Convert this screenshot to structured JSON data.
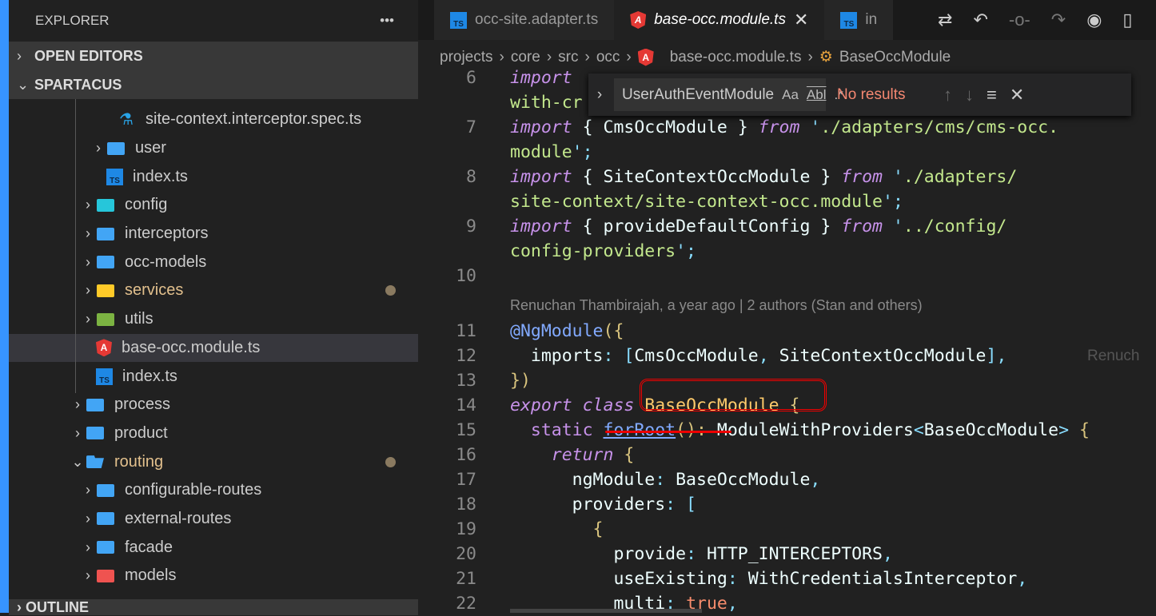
{
  "sidebar": {
    "title": "EXPLORER",
    "more_icon": "ellipsis-icon",
    "sections": {
      "open_editors": "OPEN EDITORS",
      "workspace": "SPARTACUS",
      "outline": "OUTLINE"
    },
    "tree": [
      {
        "label": "site-context.interceptor.spec.ts",
        "icon": "test-flask-icon",
        "depth": 3,
        "chevron": "none"
      },
      {
        "label": "user",
        "icon": "folder-icon",
        "depth": 2,
        "chevron": "right"
      },
      {
        "label": "index.ts",
        "icon": "typescript-icon",
        "depth": 2,
        "chevron": "none"
      },
      {
        "label": "config",
        "icon": "folder-config-icon",
        "depth": 1,
        "chevron": "right"
      },
      {
        "label": "interceptors",
        "icon": "folder-icon",
        "depth": 1,
        "chevron": "right"
      },
      {
        "label": "occ-models",
        "icon": "folder-icon",
        "depth": 1,
        "chevron": "right"
      },
      {
        "label": "services",
        "icon": "folder-services-icon",
        "depth": 1,
        "chevron": "right",
        "modified": true
      },
      {
        "label": "utils",
        "icon": "folder-utils-icon",
        "depth": 1,
        "chevron": "right"
      },
      {
        "label": "base-occ.module.ts",
        "icon": "angular-icon",
        "depth": 1,
        "chevron": "none",
        "selected": true
      },
      {
        "label": "index.ts",
        "icon": "typescript-icon",
        "depth": 1,
        "chevron": "none"
      },
      {
        "label": "process",
        "icon": "folder-icon",
        "depth": 0,
        "chevron": "right"
      },
      {
        "label": "product",
        "icon": "folder-icon",
        "depth": 0,
        "chevron": "right"
      },
      {
        "label": "routing",
        "icon": "folder-open-icon",
        "depth": 0,
        "chevron": "down",
        "modified": true
      },
      {
        "label": "configurable-routes",
        "icon": "folder-icon",
        "depth": 1,
        "chevron": "right"
      },
      {
        "label": "external-routes",
        "icon": "folder-icon",
        "depth": 1,
        "chevron": "right"
      },
      {
        "label": "facade",
        "icon": "folder-icon",
        "depth": 1,
        "chevron": "right"
      },
      {
        "label": "models",
        "icon": "folder-models-icon",
        "depth": 1,
        "chevron": "right"
      }
    ]
  },
  "tabs": [
    {
      "label": "occ-site.adapter.ts",
      "icon": "typescript-icon"
    },
    {
      "label": "base-occ.module.ts",
      "icon": "angular-icon",
      "active": true
    },
    {
      "label": "in",
      "icon": "typescript-icon"
    }
  ],
  "toolbar_icons": [
    "source-control-compare-icon",
    "go-back-icon",
    "git-commit-icon",
    "go-forward-icon",
    "git-graph-icon",
    "split-editor-icon"
  ],
  "breadcrumb": [
    "projects",
    "core",
    "src",
    "occ",
    "base-occ.module.ts",
    "BaseOccModule"
  ],
  "find": {
    "value": "UserAuthEventModule",
    "match_case": "Aa",
    "whole_word": "Abl",
    "regex": ".*",
    "status": "No results"
  },
  "code": [
    {
      "n": "6",
      "t": [
        [
          "import",
          "kw"
        ]
      ]
    },
    {
      "n": "",
      "t": [
        [
          "with-cr",
          "st"
        ]
      ]
    },
    {
      "n": "7",
      "t": [
        [
          "import",
          "kw"
        ],
        [
          " { CmsOccModule } ",
          ""
        ],
        [
          "from",
          "kw"
        ],
        [
          " '",
          "pu"
        ],
        [
          "./adapters/cms/cms-occ.",
          "st"
        ]
      ]
    },
    {
      "n": "",
      "t": [
        [
          "module",
          "st"
        ],
        [
          "';",
          "pu"
        ]
      ]
    },
    {
      "n": "8",
      "t": [
        [
          "import",
          "kw"
        ],
        [
          " { SiteContextOccModule } ",
          ""
        ],
        [
          "from",
          "kw"
        ],
        [
          " '",
          "pu"
        ],
        [
          "./adapters/",
          "st"
        ]
      ]
    },
    {
      "n": "",
      "t": [
        [
          "site-context/site-context-occ.module",
          "st"
        ],
        [
          "';",
          "pu"
        ]
      ]
    },
    {
      "n": "9",
      "t": [
        [
          "import",
          "kw"
        ],
        [
          " { provideDefaultConfig } ",
          ""
        ],
        [
          "from",
          "kw"
        ],
        [
          " '",
          "pu"
        ],
        [
          "../config/",
          "st"
        ]
      ]
    },
    {
      "n": "",
      "t": [
        [
          "config-providers",
          "st"
        ],
        [
          "';",
          "pu"
        ]
      ]
    },
    {
      "n": "10",
      "t": []
    },
    {
      "n": "",
      "blame": "Renuchan Thambirajah, a year ago | 2 authors (Stan and others)"
    },
    {
      "n": "11",
      "t": [
        [
          "@NgModule",
          "fn"
        ],
        [
          "({",
          "br"
        ]
      ]
    },
    {
      "n": "12",
      "t": [
        [
          "  imports",
          ""
        ],
        [
          ": [",
          "pu"
        ],
        [
          "CmsOccModule",
          ""
        ],
        [
          ", ",
          "pu"
        ],
        [
          "SiteContextOccModule",
          ""
        ],
        [
          "],",
          "pu"
        ]
      ],
      "ghost": "Renuch"
    },
    {
      "n": "13",
      "t": [
        [
          "})",
          "br"
        ]
      ]
    },
    {
      "n": "14",
      "t": [
        [
          "export class",
          "kw"
        ],
        [
          " ",
          ""
        ],
        [
          "BaseOccModule",
          "cn"
        ],
        [
          " {",
          "br"
        ]
      ]
    },
    {
      "n": "15",
      "t": [
        [
          "  static ",
          "st2"
        ],
        [
          "forRoot",
          "fn"
        ],
        [
          "(): ",
          "br"
        ],
        [
          "ModuleWithProviders",
          ""
        ],
        [
          "<",
          "pu"
        ],
        [
          "BaseOccModule",
          ""
        ],
        [
          "> ",
          "pu"
        ],
        [
          "{",
          "br"
        ]
      ]
    },
    {
      "n": "16",
      "t": [
        [
          "    return",
          "kw"
        ],
        [
          " {",
          "br"
        ]
      ]
    },
    {
      "n": "17",
      "t": [
        [
          "      ngModule",
          ""
        ],
        [
          ": ",
          "pu"
        ],
        [
          "BaseOccModule",
          ""
        ],
        [
          ",",
          "pu"
        ]
      ]
    },
    {
      "n": "18",
      "t": [
        [
          "      providers",
          ""
        ],
        [
          ": [",
          "pu"
        ]
      ]
    },
    {
      "n": "19",
      "t": [
        [
          "        {",
          "br"
        ]
      ]
    },
    {
      "n": "20",
      "t": [
        [
          "          provide",
          ""
        ],
        [
          ": ",
          "pu"
        ],
        [
          "HTTP_INTERCEPTORS",
          ""
        ],
        [
          ",",
          "pu"
        ]
      ]
    },
    {
      "n": "21",
      "t": [
        [
          "          useExisting",
          ""
        ],
        [
          ": ",
          "pu"
        ],
        [
          "WithCredentialsInterceptor",
          ""
        ],
        [
          ",",
          "pu"
        ]
      ]
    },
    {
      "n": "22",
      "t": [
        [
          "          multi",
          ""
        ],
        [
          ": ",
          "pu"
        ],
        [
          "true",
          "bo"
        ],
        [
          ",",
          "pu"
        ]
      ]
    }
  ],
  "colors": {
    "accent": "#3794ff",
    "annotation": "#e00000",
    "no_results": "#f48771"
  }
}
